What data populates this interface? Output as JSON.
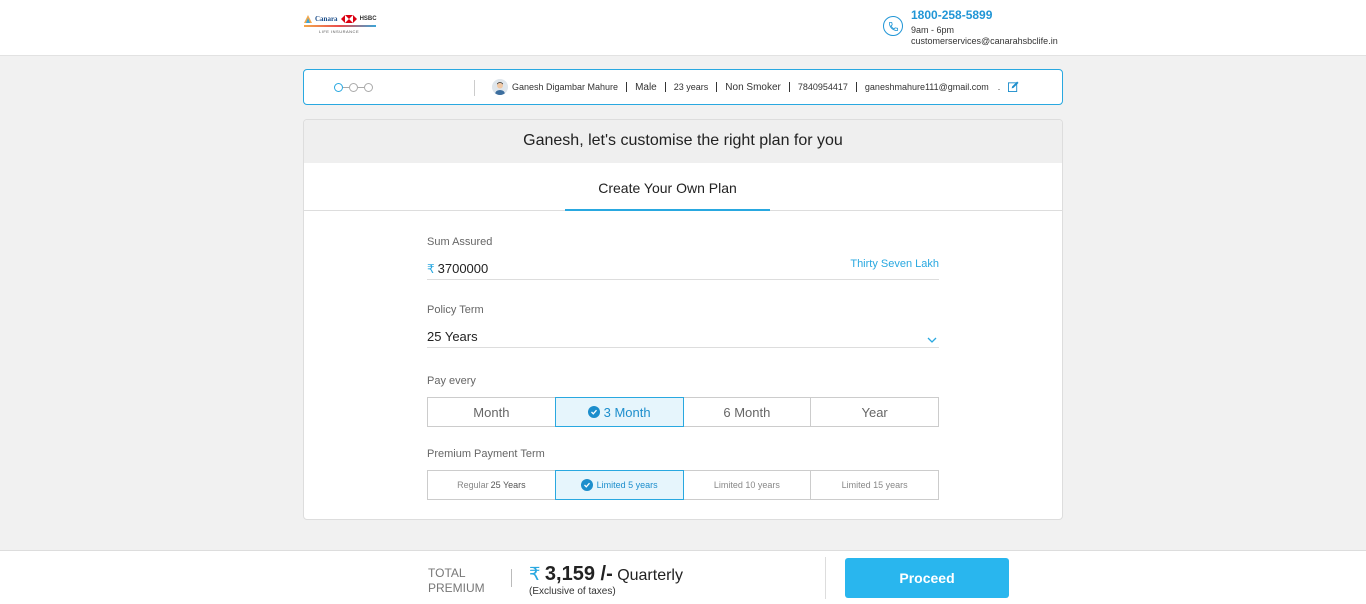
{
  "header": {
    "logo": {
      "brand": "Canara",
      "partner": "HSBC",
      "sub": "LIFE INSURANCE"
    },
    "contact": {
      "phone": "1800-258-5899",
      "hours": "9am - 6pm",
      "email": "customerservices@canarahsbclife.in"
    }
  },
  "profile": {
    "name": "Ganesh Digambar Mahure",
    "gender": "Male",
    "age": "23 years",
    "smoker": "Non Smoker",
    "mobile": "7840954417",
    "email": "ganeshmahure111@gmail.com",
    "trail": "."
  },
  "card": {
    "heading": "Ganesh, let's customise the right plan for you",
    "tab": "Create Your Own Plan"
  },
  "form": {
    "sum_assured": {
      "label": "Sum Assured",
      "currency": "₹",
      "value": "3700000",
      "words": "Thirty Seven Lakh"
    },
    "policy_term": {
      "label": "Policy Term",
      "value": "25 Years"
    },
    "pay_every": {
      "label": "Pay every",
      "options": [
        "Month",
        "3 Month",
        "6 Month",
        "Year"
      ],
      "selected": "3 Month"
    },
    "premium_term": {
      "label": "Premium Payment Term",
      "options": [
        {
          "prefix": "Regular",
          "value": "25 Years"
        },
        {
          "prefix": "",
          "value": "Limited 5 years"
        },
        {
          "prefix": "",
          "value": "Limited 10 years"
        },
        {
          "prefix": "",
          "value": "Limited 15 years"
        }
      ],
      "selected": "Limited 5 years"
    }
  },
  "footer": {
    "total_line1": "TOTAL",
    "total_line2": "PREMIUM",
    "currency": "₹",
    "amount": "3,159 /-",
    "period": "Quarterly",
    "note": "(Exclusive of taxes)",
    "proceed": "Proceed"
  },
  "colors": {
    "accent": "#29a8e0",
    "button": "#29b6ee",
    "selected_bg": "#e6f5fc"
  }
}
